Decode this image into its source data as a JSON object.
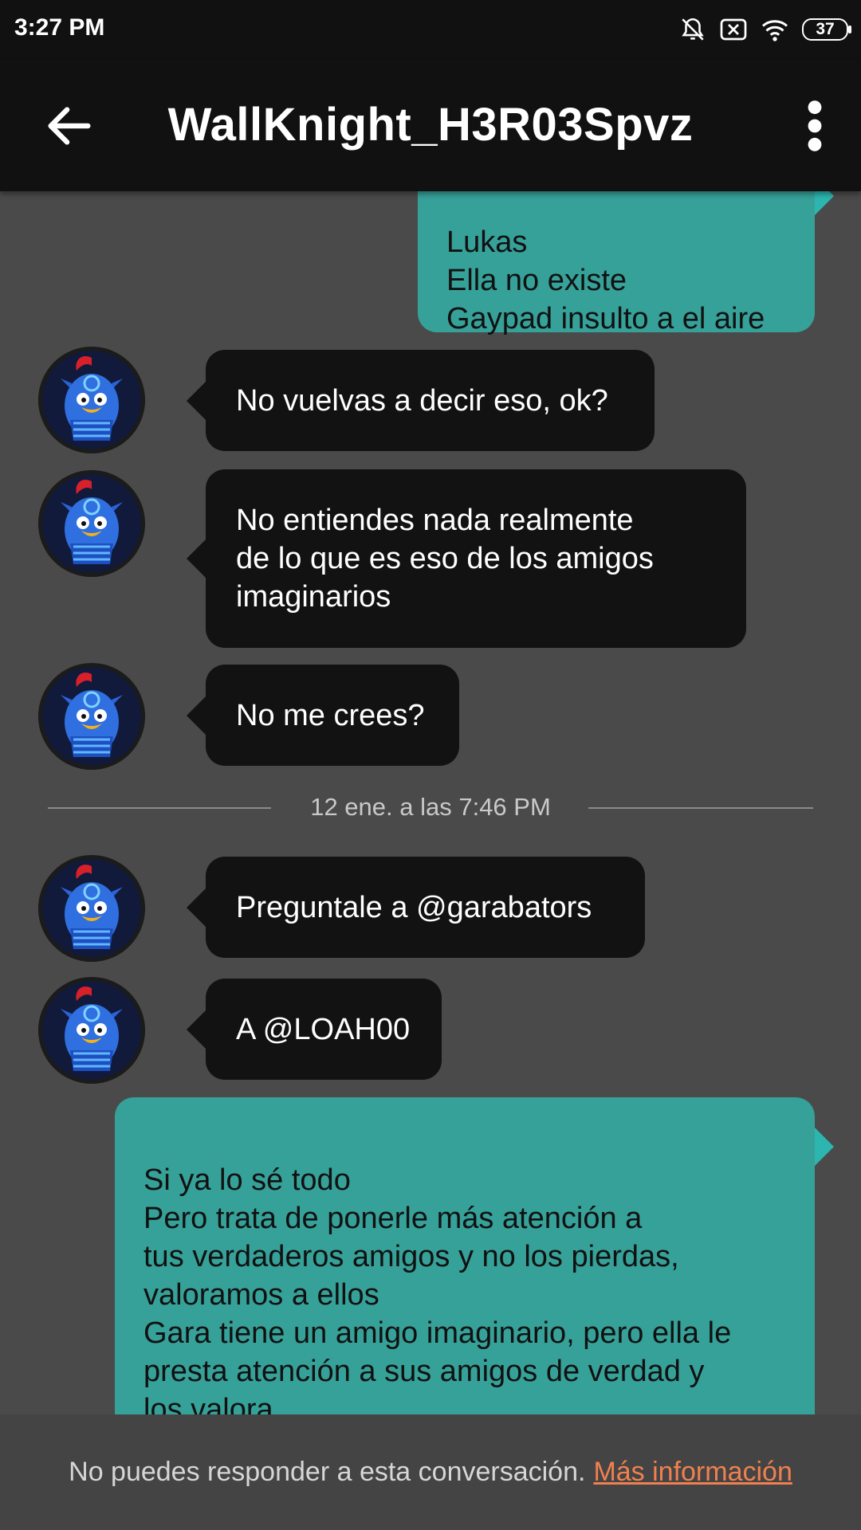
{
  "status_bar": {
    "time": "3:27 PM",
    "battery": "37",
    "icons": [
      "notifications-off-icon",
      "sim-off-icon",
      "wifi-icon",
      "battery-icon"
    ]
  },
  "header": {
    "title": "WallKnight_H3R03Spvz",
    "icons": [
      "back-arrow-icon",
      "more-vert-icon"
    ]
  },
  "messages": [
    {
      "side": "outgoing",
      "text": "Lukas\nElla no existe\nGaypad insulto a el aire"
    },
    {
      "side": "incoming",
      "text": "No vuelvas a decir eso, ok?"
    },
    {
      "side": "incoming",
      "text": "No entiendes nada realmente\nde lo que es eso de los amigos\nimaginarios"
    },
    {
      "side": "incoming",
      "text": "No me crees?"
    },
    {
      "side": "incoming",
      "text": "Preguntale a @garabators"
    },
    {
      "side": "incoming",
      "text": "A @LOAH00"
    },
    {
      "side": "outgoing",
      "text": "Si ya lo sé todo\nPero trata de ponerle más atención a\ntus verdaderos amigos y no los pierdas,\nvaloramos a ellos\nGara tiene un amigo imaginario, pero ella le\npresta atención a sus amigos de verdad y\nlos valora"
    }
  ],
  "divider": {
    "timestamp": "12 ene. a las 7:46 PM"
  },
  "footer": {
    "notice": "No puedes responder a esta conversación.",
    "link": "Más información"
  },
  "colors": {
    "bar": "#111111",
    "background": "#4a4a4a",
    "incoming_bubble": "#121212",
    "outgoing_bubble": "#36a199",
    "link": "#f08050"
  }
}
